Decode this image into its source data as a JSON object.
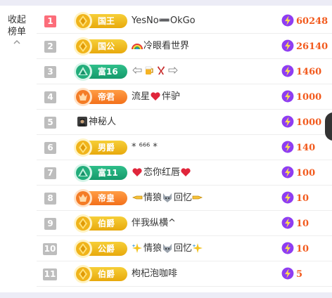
{
  "collapse": {
    "label": "收起榜单",
    "icon": "chevron-up-icon"
  },
  "colors": {
    "gold_badge": "#e8a90c",
    "green_badge": "#15996b",
    "orange_badge": "#f3701a",
    "score_text": "#f25a1d",
    "bolt_circle": "#8e3df2",
    "rank_top": "#fc6d7a",
    "rank_other": "#bdbdbd"
  },
  "rows": [
    {
      "rank": "1",
      "badge": "国王",
      "badge_style": "gold",
      "name": "YesNo➖OkGo",
      "emojis": [],
      "score": "60248"
    },
    {
      "rank": "2",
      "badge": "国公",
      "badge_style": "gold",
      "name": "冷眼看世界",
      "emojis": [
        "rainbow-icon"
      ],
      "score": "26140"
    },
    {
      "rank": "3",
      "badge": "富16",
      "badge_style": "green",
      "name": "",
      "emojis": [
        "hand-left-icon",
        "beer-icon",
        "ribbon-icon",
        "hand-right-icon"
      ],
      "score": "1460"
    },
    {
      "rank": "4",
      "badge": "帝君",
      "badge_style": "orange",
      "name": "流星",
      "name_suffix": "伴驴",
      "emojis": [
        "heart-icon"
      ],
      "score": "1000"
    },
    {
      "rank": "5",
      "badge": "",
      "badge_style": "",
      "name": "神秘人",
      "emojis": [
        "mystery-avatar-icon"
      ],
      "score": "1000"
    },
    {
      "rank": "6",
      "badge": "男爵",
      "badge_style": "gold",
      "name": "* ⁶⁶⁶ *",
      "emojis": [],
      "score": "140"
    },
    {
      "rank": "7",
      "badge": "富11",
      "badge_style": "green",
      "name": "恋你红唇",
      "emojis": [
        "heart-icon",
        "heart-icon"
      ],
      "score": "100"
    },
    {
      "rank": "8",
      "badge": "帝皇",
      "badge_style": "orange",
      "name": "情狼",
      "name_suffix": "回忆",
      "emojis": [
        "point-left-icon",
        "wolf-icon",
        "point-right-icon"
      ],
      "score": "10"
    },
    {
      "rank": "9",
      "badge": "伯爵",
      "badge_style": "gold",
      "name": "伴我纵横^",
      "emojis": [],
      "score": "10"
    },
    {
      "rank": "10",
      "badge": "公爵",
      "badge_style": "gold",
      "name": "情狼",
      "name_suffix": "回忆",
      "emojis": [
        "sparkle-icon",
        "wolf-icon",
        "sparkle-icon"
      ],
      "score": "10"
    },
    {
      "rank": "11",
      "badge": "伯爵",
      "badge_style": "gold",
      "name": "枸杞泡咖啡",
      "emojis": [],
      "score": "5"
    }
  ]
}
